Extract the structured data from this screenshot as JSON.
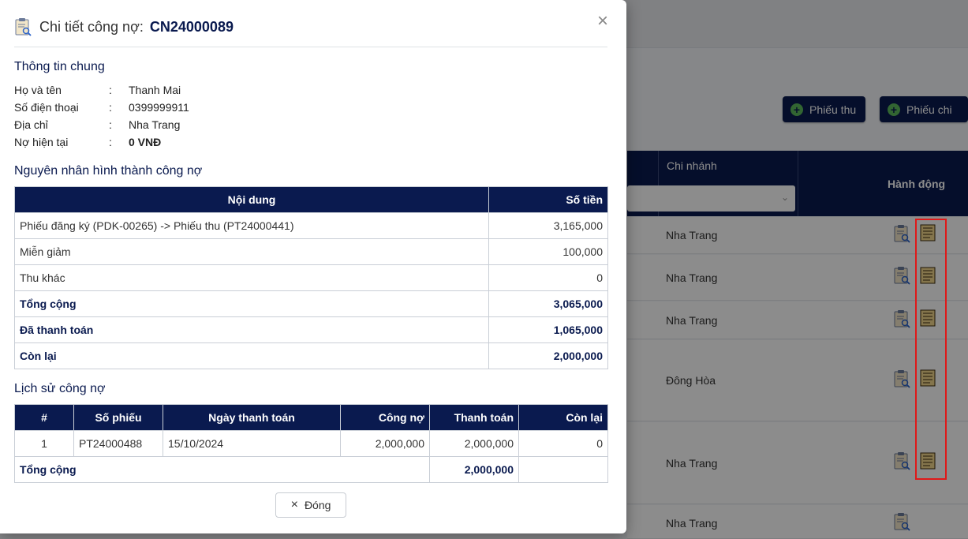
{
  "background": {
    "buttons": [
      {
        "label": "Phiếu thu",
        "icon": "plus-circle-icon"
      },
      {
        "label": "Phiếu chi",
        "icon": "plus-circle-icon"
      }
    ],
    "table": {
      "branch_header": "Chi nhánh",
      "action_header": "Hành động",
      "rows": [
        {
          "branch": "Nha Trang"
        },
        {
          "branch": "Nha Trang"
        },
        {
          "branch": "Nha Trang"
        },
        {
          "branch": "Đông Hòa"
        },
        {
          "branch": "Nha Trang"
        },
        {
          "branch": "Nha Trang"
        }
      ]
    }
  },
  "modal": {
    "title": "Chi tiết công nợ:",
    "code": "CN24000089",
    "general": {
      "title": "Thông tin chung",
      "fields": [
        {
          "label": "Họ và tên",
          "value": "Thanh Mai"
        },
        {
          "label": "Số điện thoại",
          "value": "0399999911"
        },
        {
          "label": "Địa chỉ",
          "value": "Nha Trang"
        },
        {
          "label": "Nợ hiện tại",
          "value": "0 VNĐ"
        }
      ]
    },
    "cause": {
      "title": "Nguyên nhân hình thành công nợ",
      "headers": {
        "content": "Nội dung",
        "amount": "Số tiền"
      },
      "rows": [
        {
          "content": "Phiếu đăng ký (PDK-00265) -> Phiếu thu (PT24000441)",
          "amount": "3,165,000"
        },
        {
          "content": "Miễn giảm",
          "amount": "100,000"
        },
        {
          "content": "Thu khác",
          "amount": "0"
        }
      ],
      "total": {
        "label": "Tổng cộng",
        "amount": "3,065,000"
      },
      "paid": {
        "label": "Đã thanh toán",
        "amount": "1,065,000"
      },
      "remaining": {
        "label": "Còn lại",
        "amount": "2,000,000"
      }
    },
    "history": {
      "title": "Lịch sử công nợ",
      "headers": {
        "index": "#",
        "receipt": "Số phiếu",
        "date": "Ngày thanh toán",
        "debt": "Công nợ",
        "payment": "Thanh toán",
        "remaining": "Còn lại"
      },
      "rows": [
        {
          "index": "1",
          "receipt": "PT24000488",
          "date": "15/10/2024",
          "debt": "2,000,000",
          "payment": "2,000,000",
          "remaining": "0"
        }
      ],
      "total": {
        "label": "Tổng cộng",
        "payment": "2,000,000"
      }
    },
    "close_label": "Đóng"
  },
  "colors": {
    "header_navy": "#0a1a4f",
    "accent_green": "#5cb85c",
    "highlight_red": "#e01919"
  }
}
